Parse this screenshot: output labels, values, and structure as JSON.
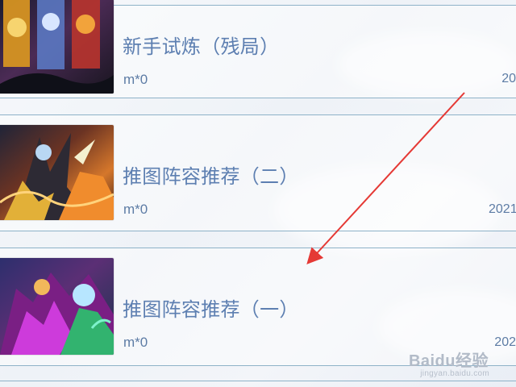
{
  "articles": [
    {
      "title": "新手试炼（残局）",
      "meta": "m*0",
      "date": "20"
    },
    {
      "title": "推图阵容推荐（二）",
      "meta": "m*0",
      "date": "2021"
    },
    {
      "title": "推图阵容推荐（一）",
      "meta": "m*0",
      "date": "202"
    }
  ],
  "watermark": {
    "brand": "Baidu经验",
    "site": "jingyan.baidu.com"
  },
  "colors": {
    "accent": "#5d7fb1",
    "arrow": "#e53935",
    "divider": "#8eb2c8"
  }
}
